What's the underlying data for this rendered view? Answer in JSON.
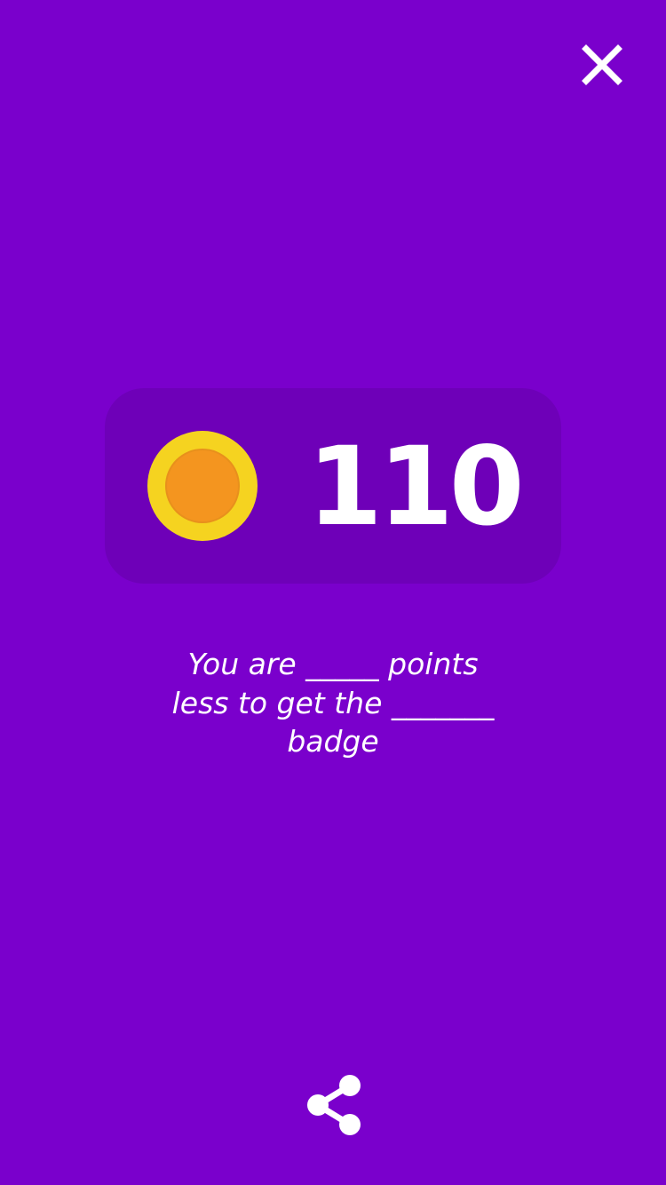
{
  "colors": {
    "background": "#7a00cc",
    "card": "#6e00b8",
    "coin_ring": "#f5d320",
    "coin_center": "#f4951f",
    "text": "#ffffff"
  },
  "header": {
    "close_icon": "close-icon"
  },
  "points": {
    "value": "110",
    "icon": "coin-icon"
  },
  "message": {
    "line1": "You are _____ points",
    "line2": "less to get the _______",
    "line3": "badge"
  },
  "footer": {
    "share_icon": "share-icon"
  }
}
